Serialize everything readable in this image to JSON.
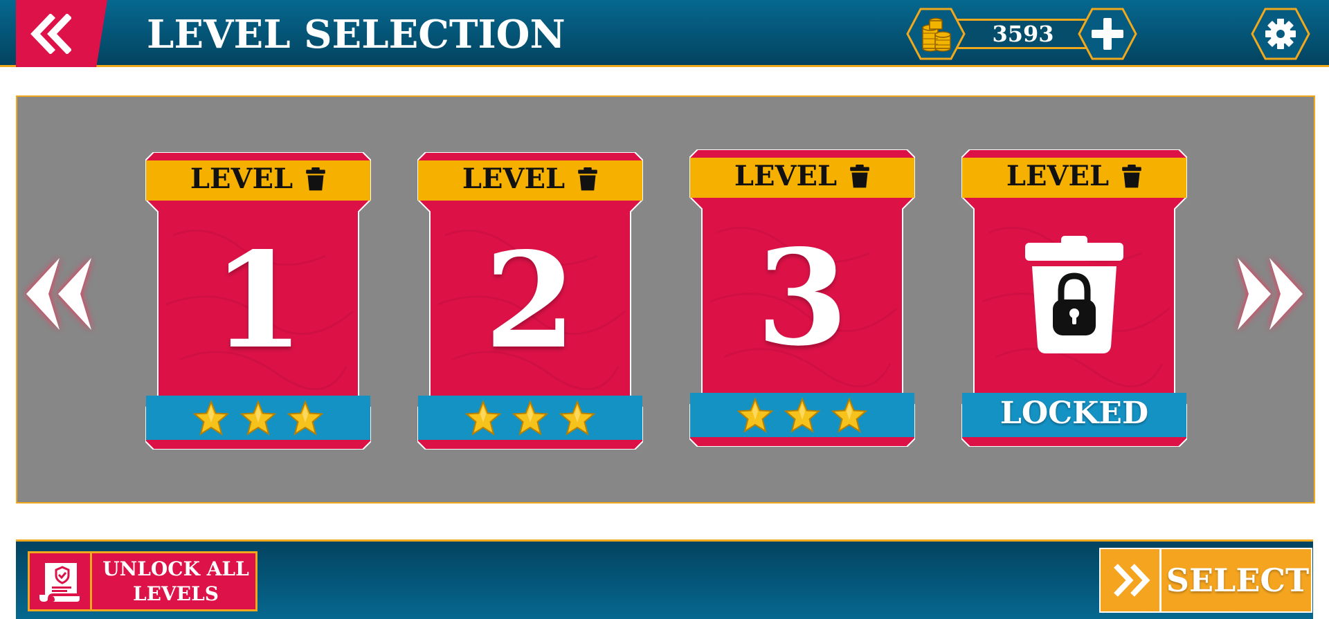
{
  "header": {
    "title": "LEVEL SELECTION",
    "coins": "3593",
    "back_icon": "double-chevron-left-icon",
    "coin_icon": "coin-stack-icon",
    "add_icon": "plus-icon",
    "settings_icon": "gear-icon"
  },
  "levels": [
    {
      "label": "LEVEL",
      "number": "1",
      "stars": 3,
      "locked": false
    },
    {
      "label": "LEVEL",
      "number": "2",
      "stars": 3,
      "locked": false
    },
    {
      "label": "LEVEL",
      "number": "3",
      "stars": 3,
      "locked": false
    },
    {
      "label": "LEVEL",
      "number": "",
      "stars": 0,
      "locked": true,
      "status": "LOCKED"
    }
  ],
  "carousel": {
    "prev_icon": "double-chevron-left-icon",
    "next_icon": "double-chevron-right-icon"
  },
  "footer": {
    "unlock_label_line1": "UNLOCK ALL",
    "unlock_label_line2": "LEVELS",
    "unlock_icon": "certificate-scroll-icon",
    "select_label": "SELECT",
    "select_icon": "double-chevron-right-icon"
  },
  "colors": {
    "header_blue": "#06688f",
    "accent_red": "#dd1249",
    "accent_gold": "#f0a81c",
    "stars_blue": "#1592c4",
    "panel_gray": "#878787",
    "select_orange": "#f4a41f"
  }
}
